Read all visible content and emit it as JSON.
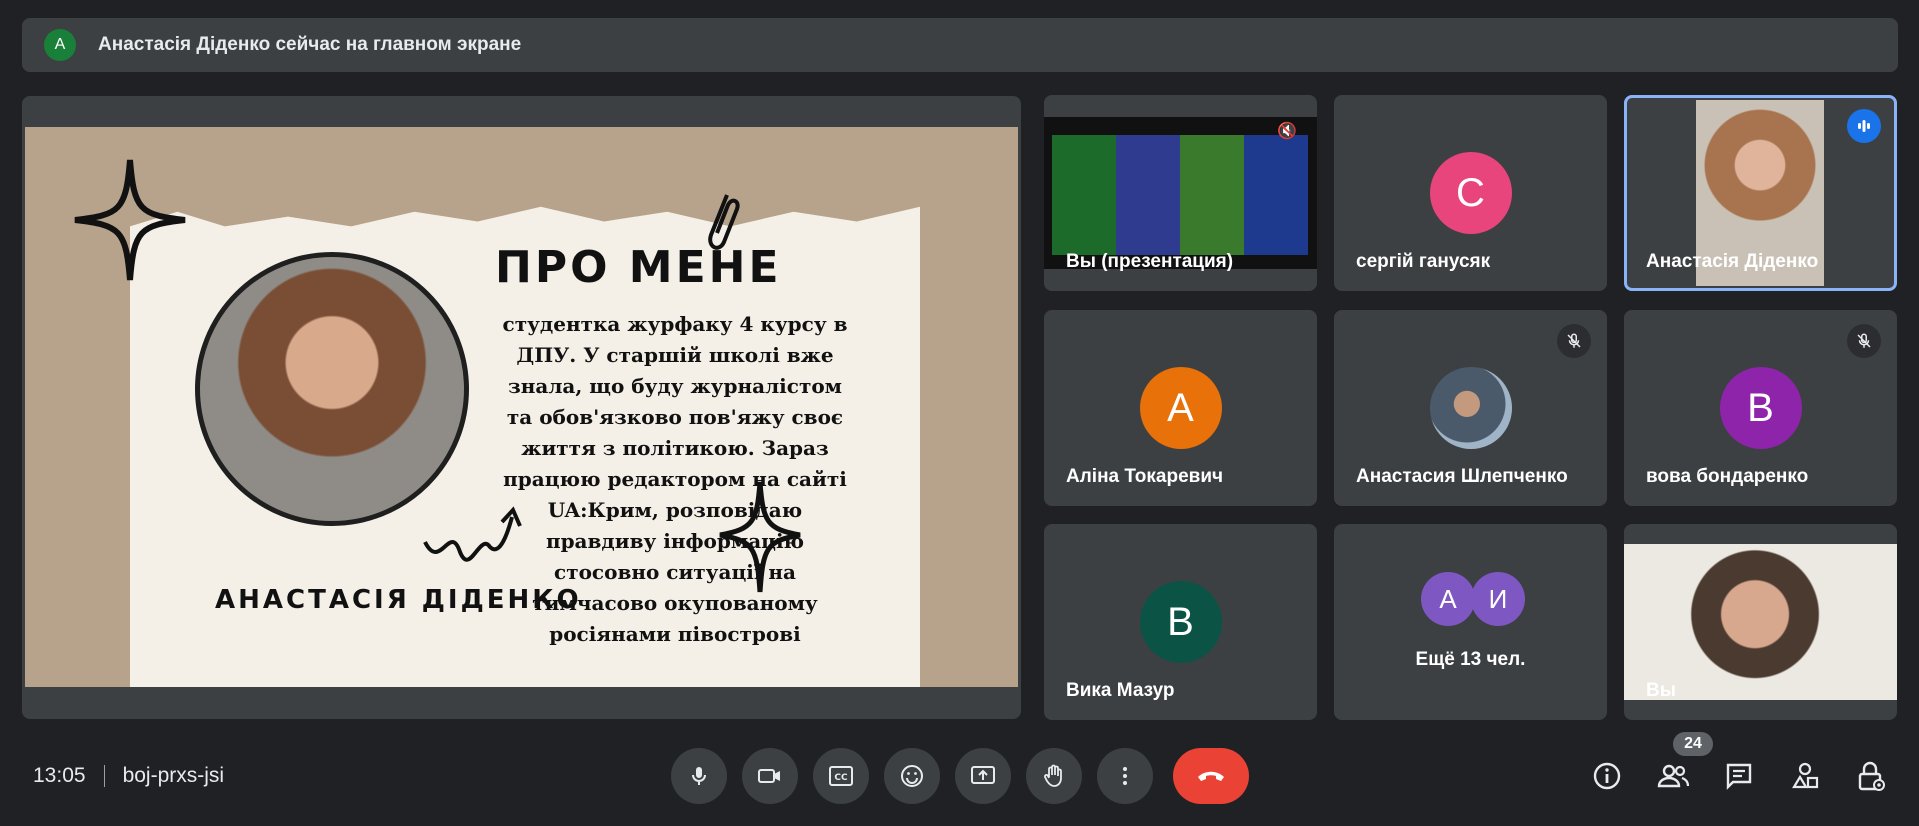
{
  "banner": {
    "avatar_letter": "А",
    "text": "Анастасія Діденко сейчас на главном экране"
  },
  "slide": {
    "title": "ПРО МЕНЕ",
    "body": "студентка журфаку 4 курсу в ДПУ. У старшій школі вже знала, що буду журналістом та обов'язково пов'яжу своє життя з політикою. Зараз працюю редактором на сайті UA:Крим, розповідаю правдиву інформацію стосовно ситуації на тимчасово окупованому росіянами півострові",
    "name": "АНАСТАСІЯ ДІДЕНКО"
  },
  "tiles": [
    {
      "label": "Вы (презентация)",
      "type": "presentation"
    },
    {
      "label": "сергій ганусяк",
      "letter": "С",
      "color": "#e8457c"
    },
    {
      "label": "Анастасія Діденко",
      "type": "video",
      "active": true
    },
    {
      "label": "Аліна Токаревич",
      "letter": "А",
      "color": "#e8710a"
    },
    {
      "label": "Анастасия Шлепченко",
      "type": "photo",
      "muted": true
    },
    {
      "label": "вова бондаренко",
      "letter": "В",
      "color": "#8e24aa",
      "muted": true
    },
    {
      "label": "Вика Мазур",
      "letter": "В",
      "color": "#0b5345"
    },
    {
      "label": "Ещё 13 чел.",
      "letters": [
        "А",
        "И"
      ],
      "color": "#7e57c2"
    },
    {
      "label": "Вы",
      "type": "video"
    }
  ],
  "bottom": {
    "time": "13:05",
    "meeting_code": "boj-prxs-jsi",
    "participant_count": "24"
  },
  "icons": [
    "mic-icon",
    "camera-icon",
    "captions-icon",
    "emoji-icon",
    "present-icon",
    "raise-hand-icon",
    "more-vert-icon",
    "end-call-icon",
    "info-icon",
    "people-icon",
    "chat-icon",
    "activities-icon",
    "host-controls-icon"
  ]
}
